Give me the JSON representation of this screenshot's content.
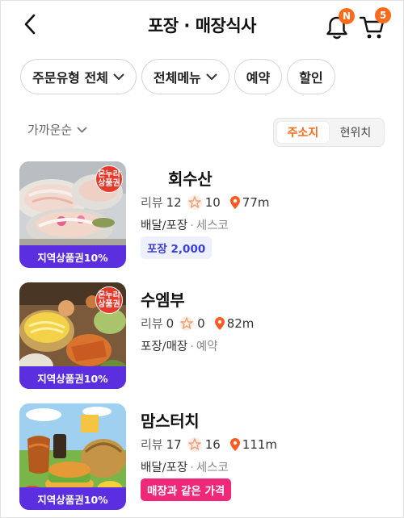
{
  "header": {
    "title": "포장 · 매장식사",
    "bell_badge": "N",
    "cart_badge": "5"
  },
  "filters": [
    {
      "label": "주문유형 전체",
      "dropdown": true
    },
    {
      "label": "전체메뉴",
      "dropdown": true
    },
    {
      "label": "예약",
      "dropdown": false
    },
    {
      "label": "할인",
      "dropdown": false
    }
  ],
  "sort": {
    "label": "가까운순"
  },
  "location_toggle": {
    "options": [
      "주소지",
      "현위치"
    ],
    "selected": "주소지"
  },
  "colors": {
    "accent": "#ff6b1a",
    "voucher_band": "#5b2ee0",
    "pin": "#ff5a1f",
    "star": "#f0a07a"
  },
  "labels": {
    "review": "리뷰",
    "dot": "·"
  },
  "stores": [
    {
      "name": "회수산",
      "reviews": "12",
      "rating_count": "10",
      "distance": "77m",
      "order_types": "배달/포장",
      "extra": "세스코",
      "thumb_band": "지역상품권10%",
      "voucher_badge": [
        "온누리",
        "상품권"
      ],
      "tag": "포장 2,000",
      "tag_style": "blue"
    },
    {
      "name": "수엠부",
      "reviews": "0",
      "rating_count": "0",
      "distance": "82m",
      "order_types": "포장/매장",
      "extra": "예약",
      "thumb_band": "지역상품권10%",
      "voucher_badge": [
        "온누리",
        "상품권"
      ],
      "tag": "",
      "tag_style": ""
    },
    {
      "name": "맘스터치",
      "reviews": "17",
      "rating_count": "16",
      "distance": "111m",
      "order_types": "배달/포장",
      "extra": "세스코",
      "thumb_band": "지역상품권10%",
      "voucher_badge": [],
      "tag": "매장과 같은 가격",
      "tag_style": "pink"
    }
  ]
}
